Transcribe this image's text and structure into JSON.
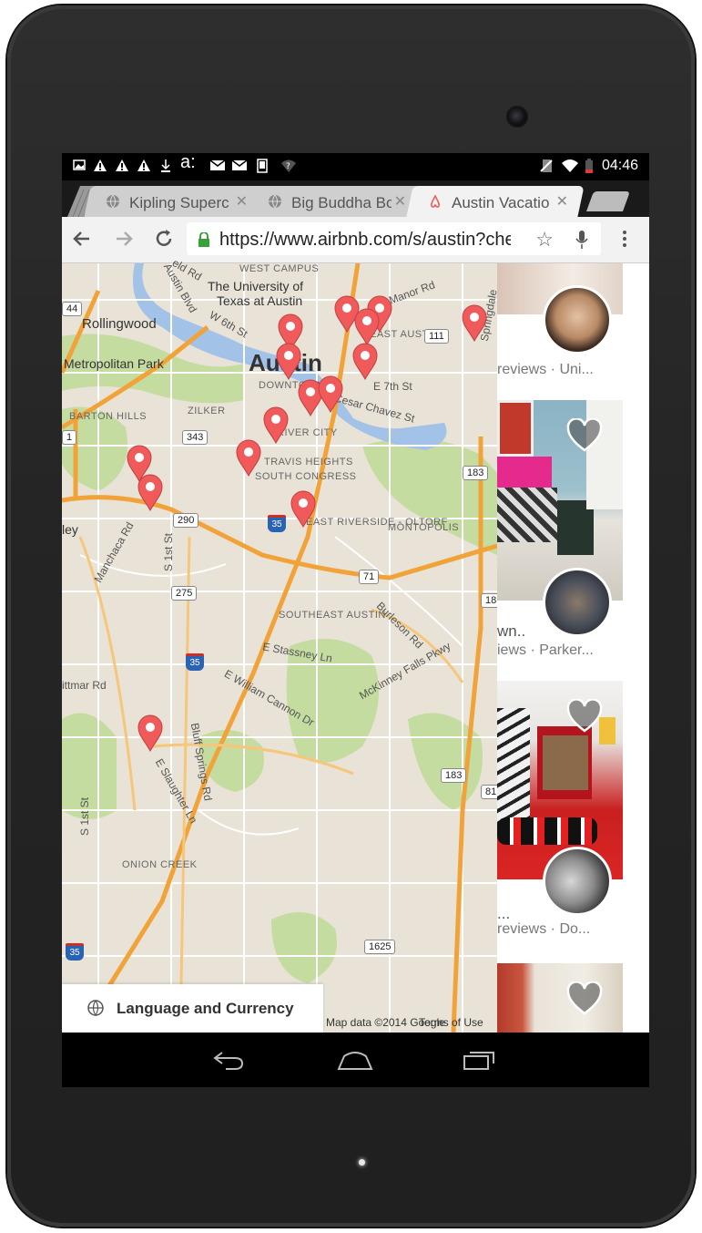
{
  "status_bar": {
    "time": "04:46",
    "left_icons": [
      "image-icon",
      "warning-icon",
      "warning-icon",
      "warning-icon",
      "download-icon",
      "app-icon",
      "mail-icon",
      "mail-icon",
      "device-icon",
      "wifi-question-icon"
    ],
    "right_icons": [
      "no-sim-icon",
      "wifi-icon",
      "battery-low-icon"
    ]
  },
  "tabs": [
    {
      "title": "Kipling Superc",
      "favicon": "globe-icon",
      "active": false
    },
    {
      "title": "Big Buddha Bo",
      "favicon": "globe-icon",
      "active": false
    },
    {
      "title": "Austin Vacatio",
      "favicon": "airbnb-icon",
      "active": true
    }
  ],
  "toolbar": {
    "url": "https://www.airbnb.com/s/austin?che"
  },
  "map": {
    "labels": {
      "west_campus": "WEST CAMPUS",
      "university": "The University of",
      "university2": "Texas at Austin",
      "rollingwood": "Rollingwood",
      "metropolitan_park": "Metropolitan Park",
      "austin": "Austin",
      "east_austin": "EAST AUSTIN",
      "manor_rd": "Manor Rd",
      "e_7th_st": "E 7th St",
      "cesar_chavez": "Cesar Chavez St",
      "barton_hills": "BARTON HILLS",
      "zilker": "ZILKER",
      "downtown": "DOWNTOWN",
      "river_city": "RIVER CITY",
      "travis_heights": "TRAVIS HEIGHTS",
      "south_congress": "SOUTH CONGRESS",
      "east_riverside": "EAST RIVERSIDE - OLTORF",
      "montopolis": "MONTOPOLIS",
      "manchaca_rd": "Manchaca Rd",
      "s_1st_st": "S 1st St",
      "southeast_austin": "SOUTHEAST AUSTIN",
      "burleson_rd": "Burleson Rd",
      "e_stassney": "E Stassney Ln",
      "mckinney_falls": "McKinney Falls Pkwy",
      "e_william_cannon": "E William Cannon Dr",
      "bluff_springs": "Bluff Springs Rd",
      "e_slaughter": "E Slaughter Ln",
      "s_1st_st2": "S 1st St",
      "onion_creek": "ONION CREEK",
      "pittmar": "ittmar Rd",
      "ley": "ley",
      "w_6th": "W 6th St",
      "austin_blvd": "Austin Blvd",
      "springdale": "Springdale",
      "lake_austin": "eld Rd"
    },
    "shields": {
      "s44": "44",
      "s111": "111",
      "s343": "343",
      "s1": "1",
      "s183a": "183",
      "s290": "290",
      "s35a": "35",
      "s71": "71",
      "s275": "275",
      "s183b": "183",
      "s35b": "35",
      "s183c": "183",
      "s81": "81",
      "s35c": "35",
      "s1625": "1625"
    },
    "credit": "Map data ©2014 Google",
    "terms": "Terms of Use",
    "language_button": "Language and Currency"
  },
  "listings": [
    {
      "meta": "reviews · Uni...",
      "favorited": false
    },
    {
      "title": "wn..",
      "meta": "iews · Parker...",
      "favorited": false
    },
    {
      "title": "...",
      "meta": "reviews · Do...",
      "favorited": false
    },
    {
      "favorited": false
    }
  ],
  "colors": {
    "pin": "#f05a5b",
    "highway": "#f1a33a",
    "water": "#a3c2e8",
    "park": "#c5dca0",
    "map_bg": "#e8e3d6"
  }
}
